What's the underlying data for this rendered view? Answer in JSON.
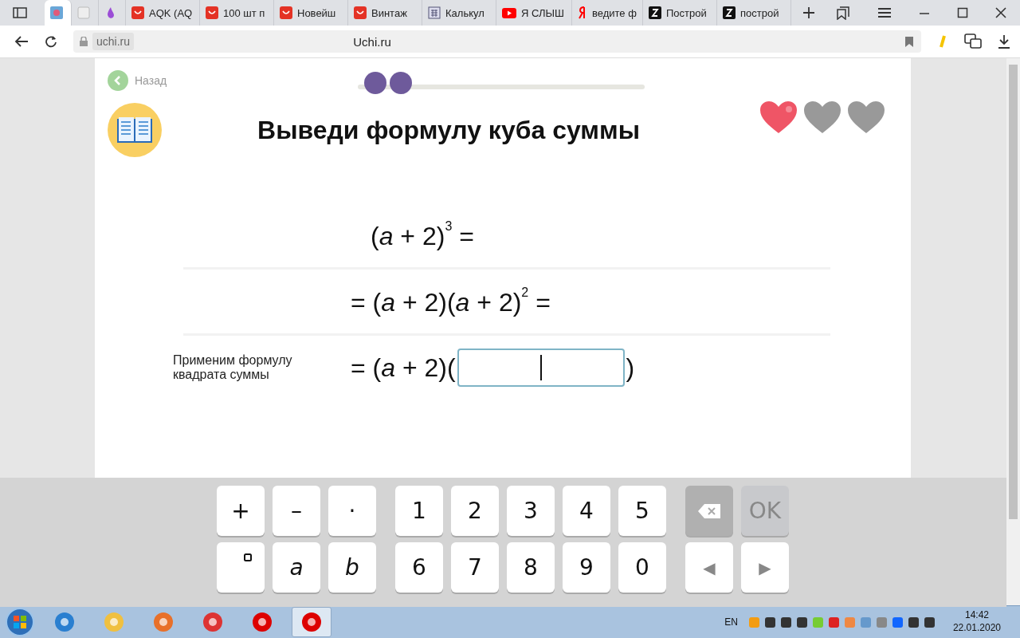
{
  "browser": {
    "tabs": [
      {
        "kind": "image",
        "selected": true
      },
      {
        "kind": "page",
        "selected": false
      },
      {
        "kind": "drop",
        "selected": false
      },
      {
        "kind": "shop",
        "title": "AQK (AQ",
        "selected": false
      },
      {
        "kind": "shop",
        "title": "100 шт п",
        "selected": false
      },
      {
        "kind": "shop",
        "title": "Новейш",
        "selected": false
      },
      {
        "kind": "shop",
        "title": "Винтаж",
        "selected": false
      },
      {
        "kind": "calc",
        "title": "Калькул",
        "selected": false
      },
      {
        "kind": "video",
        "title": "Я СЛЫШ",
        "selected": false
      },
      {
        "kind": "search",
        "title": "ведите ф",
        "selected": false
      },
      {
        "kind": "letter",
        "title": "Построй",
        "selected": false
      },
      {
        "kind": "letter",
        "title": "построй",
        "selected": false
      }
    ],
    "address_chip": "uchi.ru",
    "page_title": "Uchi.ru"
  },
  "lesson": {
    "back": "Назад",
    "steps": [
      {
        "done": true
      },
      {
        "done": true
      }
    ],
    "title": "Выведи формулу куба суммы",
    "hearts": [
      {
        "filled": true
      },
      {
        "filled": false
      },
      {
        "filled": false
      }
    ],
    "rows": [
      {
        "kind": "equation",
        "expr": "(*a* + 2)$^{3}$ ="
      },
      {
        "kind": "equation",
        "expr": "= (*a* + 2)(*a* + 2)$^{2}$ ="
      },
      {
        "kind": "answer",
        "hint": "Применим формулу квадрата суммы",
        "expr": "= (*a* + 2)(",
        "suffix": ")"
      }
    ]
  },
  "keyboard": {
    "rows": [
      [
        {
          "kind": "text",
          "label": "+"
        },
        {
          "kind": "text",
          "label": "–"
        },
        {
          "kind": "text",
          "label": "·"
        },
        {
          "kind": "gap"
        },
        {
          "kind": "text",
          "label": "1"
        },
        {
          "kind": "text",
          "label": "2"
        },
        {
          "kind": "text",
          "label": "3"
        },
        {
          "kind": "text",
          "label": "4"
        },
        {
          "kind": "text",
          "label": "5"
        },
        {
          "kind": "gap"
        },
        {
          "kind": "backspace",
          "disabled": true
        },
        {
          "kind": "text",
          "label": "OK",
          "disabled": true
        }
      ],
      [
        {
          "kind": "power"
        },
        {
          "kind": "var",
          "label": "a"
        },
        {
          "kind": "var",
          "label": "b"
        },
        {
          "kind": "gap"
        },
        {
          "kind": "text",
          "label": "6"
        },
        {
          "kind": "text",
          "label": "7"
        },
        {
          "kind": "text",
          "label": "8"
        },
        {
          "kind": "text",
          "label": "9"
        },
        {
          "kind": "text",
          "label": "0"
        },
        {
          "kind": "gap"
        },
        {
          "kind": "arrow",
          "label": "◀"
        },
        {
          "kind": "arrow",
          "label": "▶"
        }
      ]
    ]
  },
  "taskbar": {
    "apps": [
      {
        "selected": false
      },
      {
        "selected": false
      },
      {
        "selected": false
      },
      {
        "selected": false
      },
      {
        "selected": false
      },
      {
        "selected": true
      }
    ],
    "language": "EN",
    "time": "14:42",
    "date": "22.01.2020"
  }
}
